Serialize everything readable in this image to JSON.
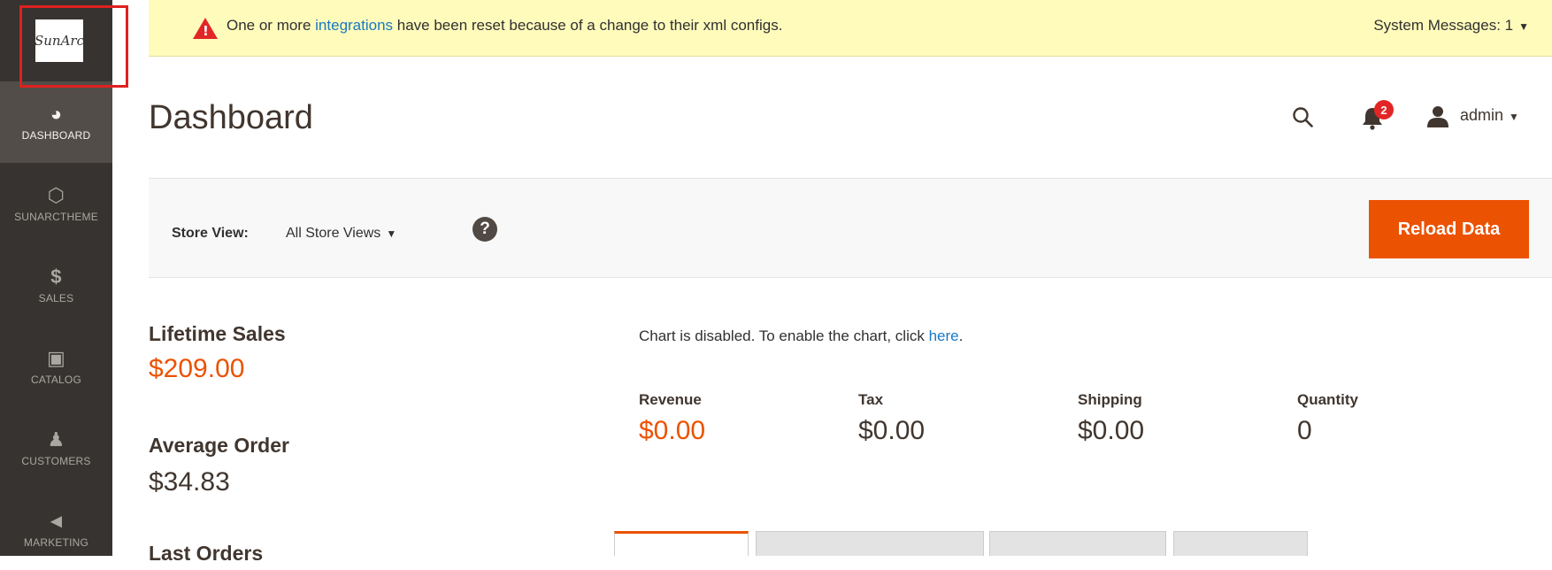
{
  "sidebar": {
    "logo_text": "SunArc",
    "items": [
      {
        "label": "DASHBOARD",
        "icon": "speedometer-icon"
      },
      {
        "label": "SUNARCTHEME",
        "icon": "hexagon-icon"
      },
      {
        "label": "SALES",
        "icon": "dollar-icon"
      },
      {
        "label": "CATALOG",
        "icon": "box-icon"
      },
      {
        "label": "CUSTOMERS",
        "icon": "person-icon"
      },
      {
        "label": "MARKETING",
        "icon": "megaphone-icon"
      }
    ]
  },
  "system_message": {
    "prefix": "One or more ",
    "link": "integrations",
    "suffix": " have been reset because of a change to their xml configs.",
    "counter": "System Messages: 1"
  },
  "header": {
    "title": "Dashboard",
    "notification_count": "2",
    "user": "admin"
  },
  "store_bar": {
    "label": "Store View:",
    "selected": "All Store Views",
    "reload_label": "Reload Data"
  },
  "summary": {
    "lifetime_label": "Lifetime Sales",
    "lifetime_value": "$209.00",
    "average_label": "Average Order",
    "average_value": "$34.83",
    "last_orders_label": "Last Orders"
  },
  "chart_notice": {
    "text": "Chart is disabled. To enable the chart, click ",
    "link": "here",
    "end": "."
  },
  "totals": [
    {
      "label": "Revenue",
      "value": "$0.00"
    },
    {
      "label": "Tax",
      "value": "$0.00"
    },
    {
      "label": "Shipping",
      "value": "$0.00"
    },
    {
      "label": "Quantity",
      "value": "0"
    }
  ],
  "colors": {
    "sidebar_bg": "#373330",
    "accent": "#eb5202",
    "link": "#1979c3",
    "message_bg": "#fffbbb"
  }
}
